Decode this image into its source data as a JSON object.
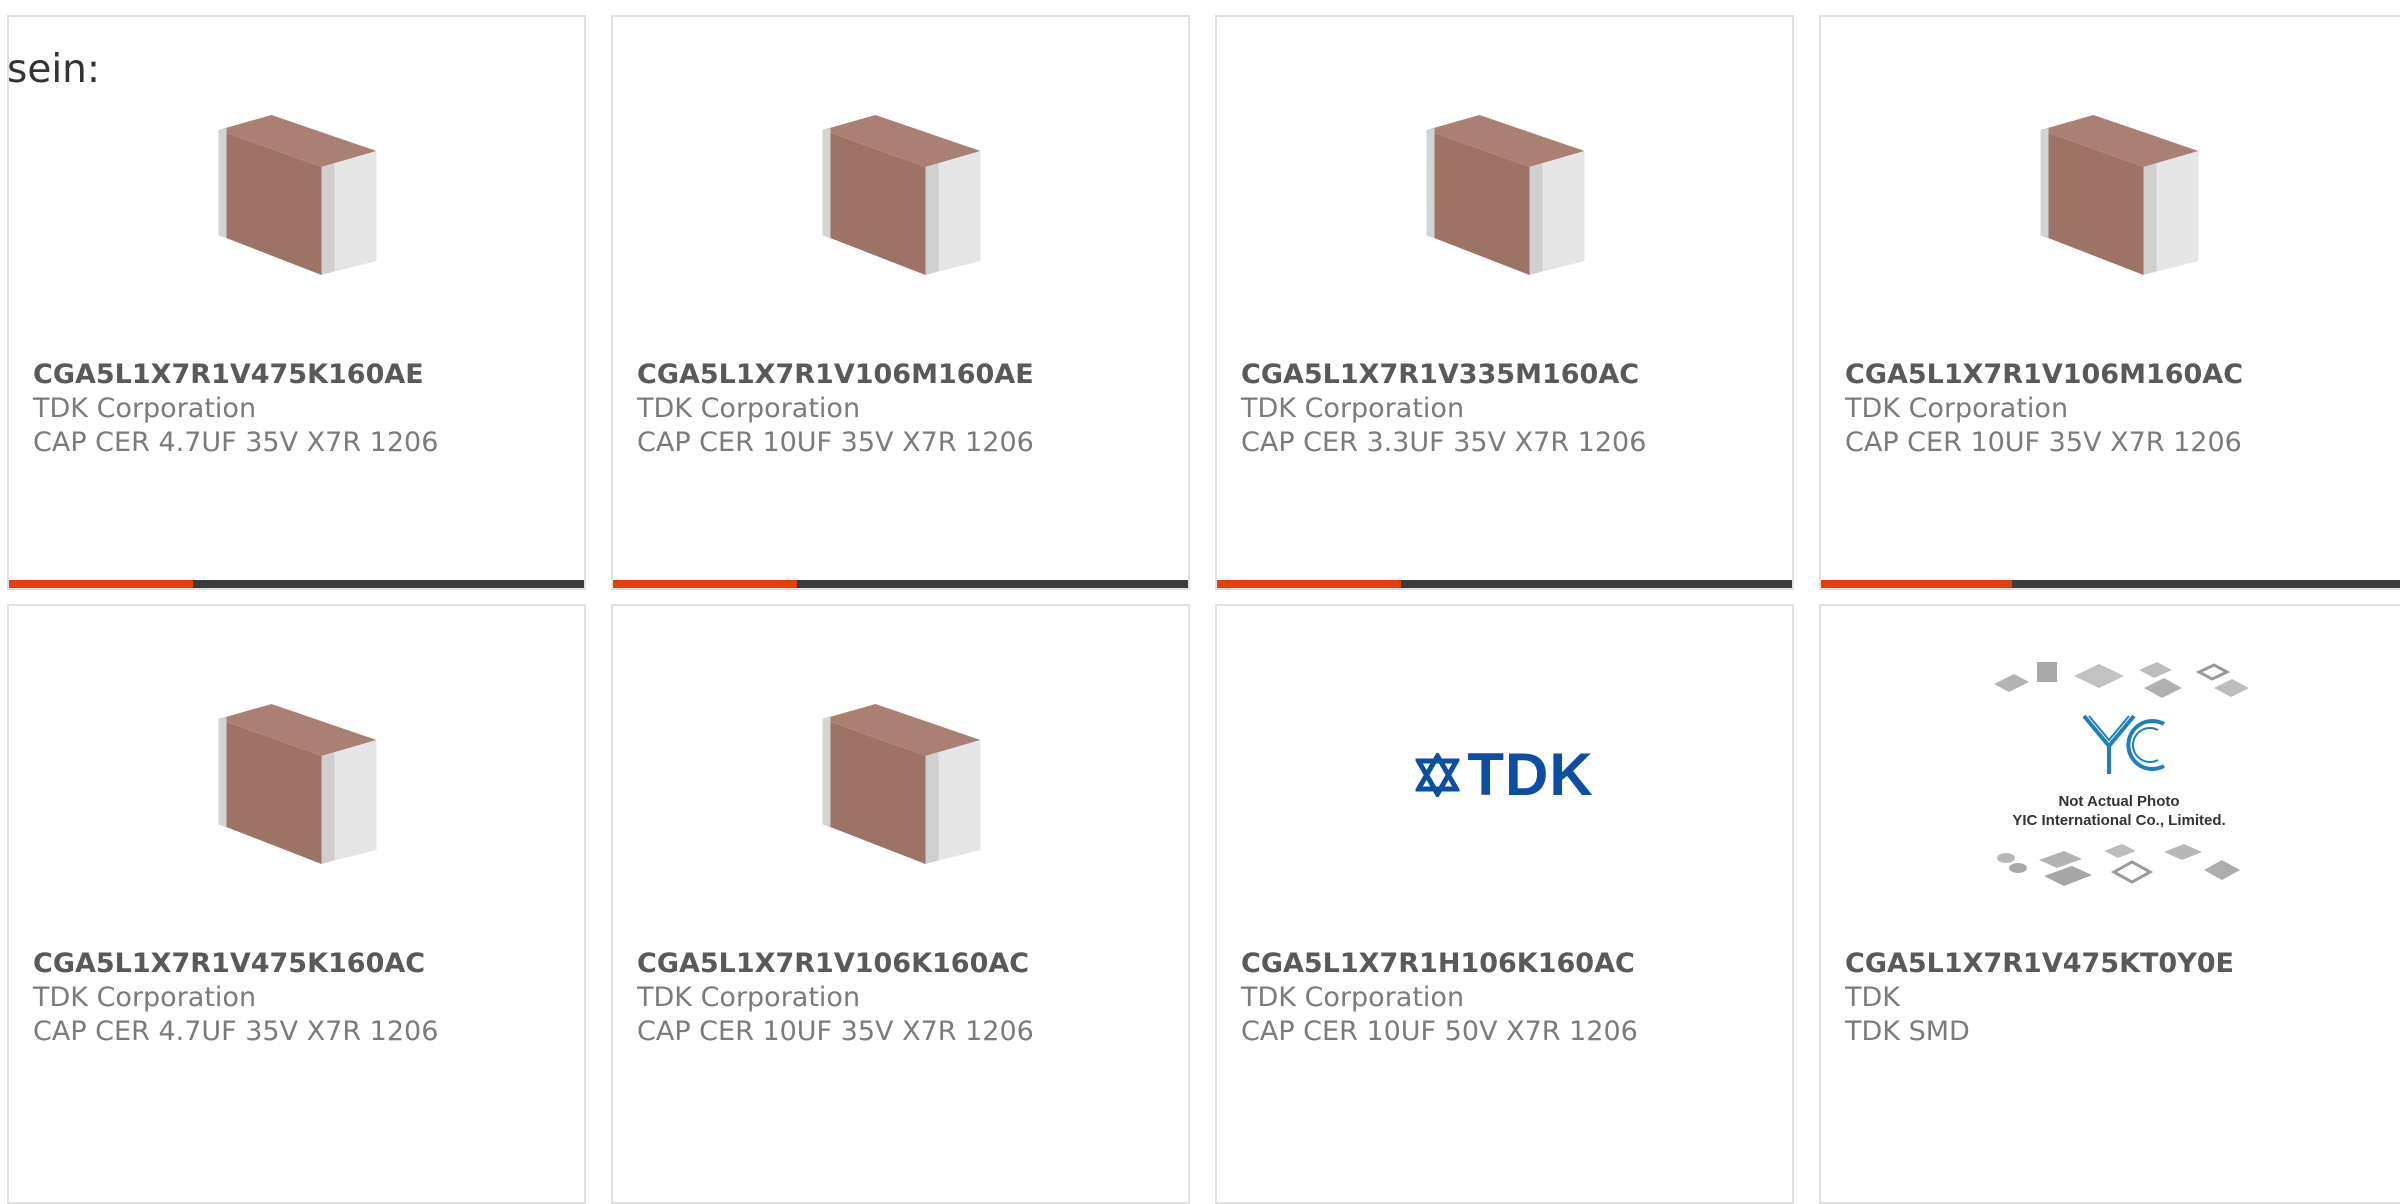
{
  "lead_text": "sein:",
  "colors": {
    "accent": "#e63d0a",
    "bar_track": "#3c3c3c",
    "part_number": "#58595b",
    "secondary_text": "#7b7b7b",
    "tdk_blue": "#0b4ea2"
  },
  "products": [
    {
      "part_number": "CGA5L1X7R1V475K160AE",
      "manufacturer": "TDK Corporation",
      "description": "CAP CER 4.7UF 35V X7R 1206",
      "image": "chip-capacitor-icon",
      "progress": 0.32
    },
    {
      "part_number": "CGA5L1X7R1V106M160AE",
      "manufacturer": "TDK Corporation",
      "description": "CAP CER 10UF 35V X7R 1206",
      "image": "chip-capacitor-icon",
      "progress": 0.32
    },
    {
      "part_number": "CGA5L1X7R1V335M160AC",
      "manufacturer": "TDK Corporation",
      "description": "CAP CER 3.3UF 35V X7R 1206",
      "image": "chip-capacitor-icon",
      "progress": 0.32
    },
    {
      "part_number": "CGA5L1X7R1V106M160AC",
      "manufacturer": "TDK Corporation",
      "description": "CAP CER 10UF 35V X7R 1206",
      "image": "chip-capacitor-icon",
      "progress": 0.32
    },
    {
      "part_number": "CGA5L1X7R1V475K160AC",
      "manufacturer": "TDK Corporation",
      "description": "CAP CER 4.7UF 35V X7R 1206",
      "image": "chip-capacitor-icon"
    },
    {
      "part_number": "CGA5L1X7R1V106K160AC",
      "manufacturer": "TDK Corporation",
      "description": "CAP CER 10UF 35V X7R 1206",
      "image": "chip-capacitor-icon"
    },
    {
      "part_number": "CGA5L1X7R1H106K160AC",
      "manufacturer": "TDK Corporation",
      "description": "CAP CER 10UF 50V X7R 1206",
      "image": "tdk-logo",
      "logo_text": "TDK"
    },
    {
      "part_number": "CGA5L1X7R1V475KT0Y0E",
      "manufacturer": "TDK",
      "description": "TDK SMD",
      "image": "yic-placeholder",
      "placeholder_line1": "Not Actual Photo",
      "placeholder_line2": "YIC International Co., Limited."
    }
  ]
}
